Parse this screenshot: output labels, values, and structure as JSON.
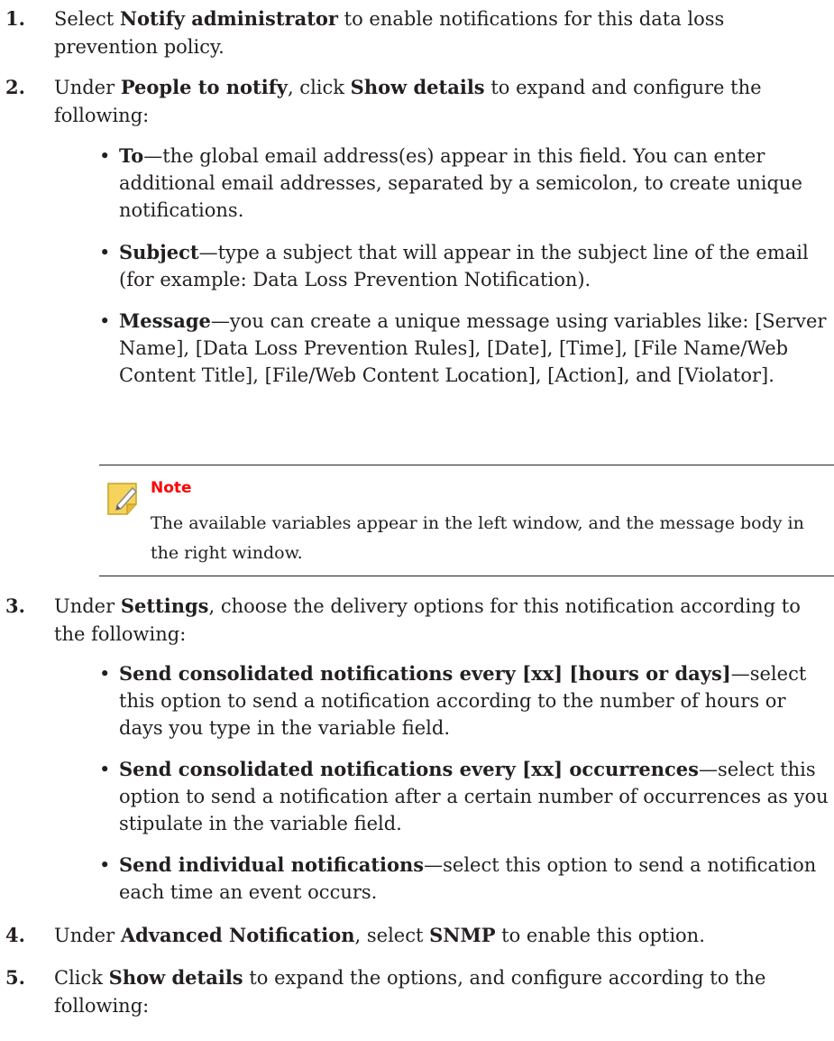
{
  "steps": [
    {
      "num": "1.",
      "pre": "Select ",
      "b1": "Notify administrator",
      "mid": " to enable notifications for this data loss prevention policy."
    },
    {
      "num": "2.",
      "pre": "Under ",
      "b1": "People to notify",
      "mid": ", click ",
      "b2": "Show details",
      "post": " to expand and configure the following:"
    },
    {
      "num": "3.",
      "pre": "Under ",
      "b1": "Settings",
      "mid": ", choose the delivery options for this notification according to the following:"
    },
    {
      "num": "4.",
      "pre": "Under ",
      "b1": "Advanced Notification",
      "mid": ", select ",
      "b2": "SNMP",
      "post": " to enable this option."
    },
    {
      "num": "5.",
      "pre": "Click ",
      "b1": "Show details",
      "mid": " to expand the options, and configure according to the following:"
    }
  ],
  "bullets_people": [
    {
      "term": "To",
      "desc": "—the global email address(es) appear in this field. You can enter additional email addresses, separated by a semicolon, to create unique notifications."
    },
    {
      "term": "Subject",
      "desc": "—type a subject that will appear in the subject line of the email (for example: Data Loss Prevention Notification)."
    },
    {
      "term": "Message",
      "desc": "—you can create a unique message using variables like: [Server Name], [Data Loss Prevention Rules], [Date], [Time], [File Name/Web Content Title], [File/Web Content Location], [Action], and [Violator]."
    }
  ],
  "note": {
    "title": "Note",
    "text": "The available variables appear in the left window, and the message body in the right window.",
    "title_color": "#ff0000",
    "icon": "note-pencil-icon"
  },
  "bullets_settings": [
    {
      "term": "Send consolidated notifications every [xx] [hours or days]",
      "desc": "—select this option to send a notification according to the number of hours or days you type in the variable field."
    },
    {
      "term": "Send consolidated notifications every [xx] occurrences",
      "desc": "—select this option to send a notification after a certain number of occurrences as you stipulate in the variable field."
    },
    {
      "term": "Send individual notifications",
      "desc": "—select this option to send a notification each time an event occurs."
    }
  ],
  "bullet_glyph": "•"
}
